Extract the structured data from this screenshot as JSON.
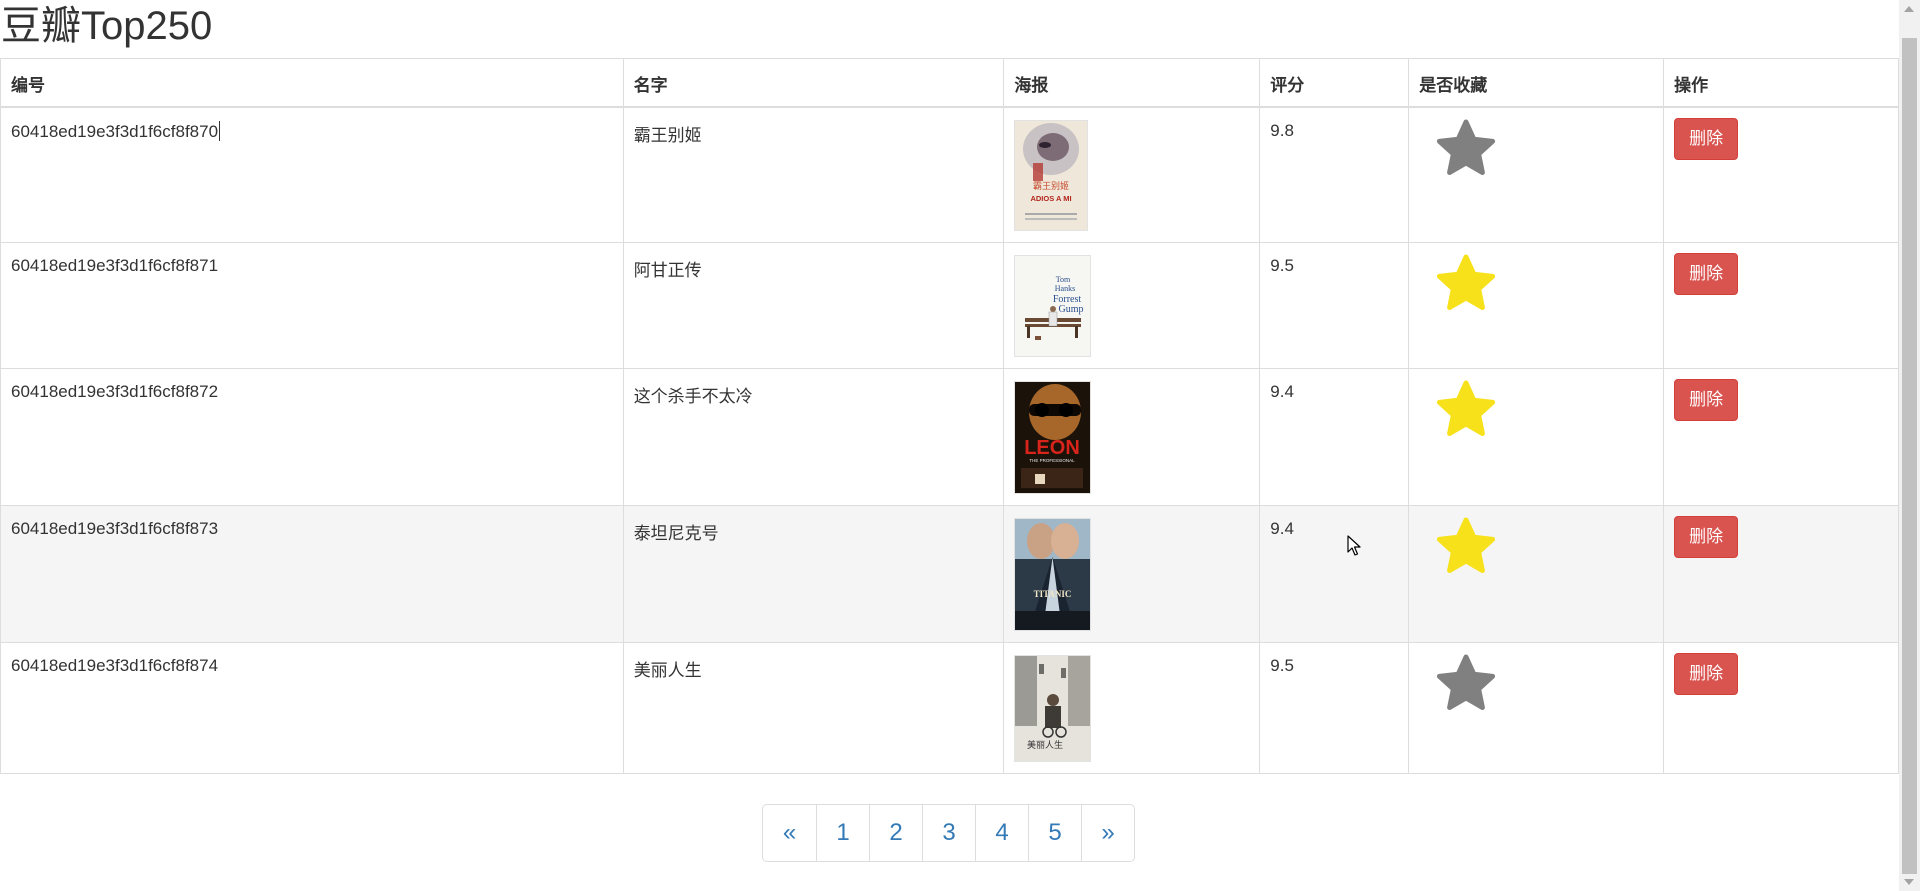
{
  "page": {
    "title": "豆瓣Top250"
  },
  "table": {
    "headers": [
      "编号",
      "名字",
      "海报",
      "评分",
      "是否收藏",
      "操作"
    ],
    "rows": [
      {
        "id": "60418ed19e3f3d1f6cf8f870",
        "name": "霸王别姬",
        "rating": "9.8",
        "favorited": false,
        "action": "删除"
      },
      {
        "id": "60418ed19e3f3d1f6cf8f871",
        "name": "阿甘正传",
        "rating": "9.5",
        "favorited": true,
        "action": "删除"
      },
      {
        "id": "60418ed19e3f3d1f6cf8f872",
        "name": "这个杀手不太冷",
        "rating": "9.4",
        "favorited": true,
        "action": "删除"
      },
      {
        "id": "60418ed19e3f3d1f6cf8f873",
        "name": "泰坦尼克号",
        "rating": "9.4",
        "favorited": true,
        "action": "删除"
      },
      {
        "id": "60418ed19e3f3d1f6cf8f874",
        "name": "美丽人生",
        "rating": "9.5",
        "favorited": false,
        "action": "删除"
      }
    ],
    "hover_row": 3
  },
  "posters": {
    "0": {
      "text": "ADIOS A MI",
      "icon": "poster-farewell-my-concubine"
    },
    "1": {
      "text": "Forrest Gump",
      "icon": "poster-forrest-gump"
    },
    "2": {
      "text": "LEON",
      "icon": "poster-leon"
    },
    "3": {
      "text": "TITANIC",
      "icon": "poster-titanic"
    },
    "4": {
      "text": "美丽人生",
      "icon": "poster-life-is-beautiful"
    }
  },
  "pagination": {
    "prev": "«",
    "pages": [
      "1",
      "2",
      "3",
      "4",
      "5"
    ],
    "next": "»"
  },
  "colors": {
    "star_on": "#f7e11b",
    "star_off": "#808080",
    "delete_btn": "#d9534f",
    "link": "#337ab7"
  }
}
